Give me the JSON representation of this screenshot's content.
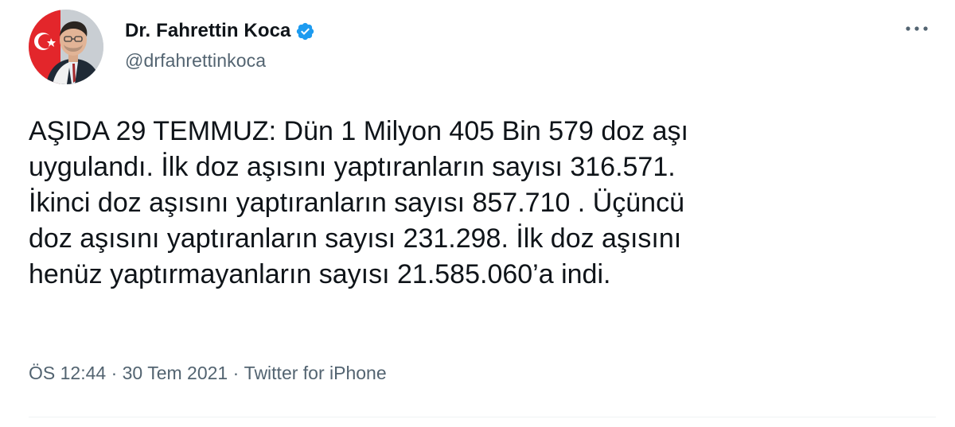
{
  "author": {
    "display_name": "Dr. Fahrettin Koca",
    "handle": "@drfahrettinkoca",
    "verified": true
  },
  "tweet": {
    "text": "AŞIDA 29 TEMMUZ: Dün 1 Milyon 405 Bin 579 doz aşı\nuygulandı. İlk doz aşısını yaptıranların sayısı 316.571.\nİkinci doz aşısını yaptıranların sayısı 857.710 . Üçüncü\ndoz aşısını yaptıranların sayısı 231.298. İlk doz aşısını\nhenüz yaptırmayanların sayısı 21.585.060’a indi."
  },
  "meta": {
    "time": "ÖS 12:44",
    "separator": " · ",
    "date": "30 Tem 2021",
    "source": "Twitter for iPhone"
  },
  "icons": {
    "verified": "verified-badge-icon",
    "more": "more-horizontal-icon"
  },
  "colors": {
    "verified_blue": "#1d9bf0",
    "text_primary": "#0f1419",
    "text_secondary": "#536471",
    "divider": "#eff3f4"
  }
}
